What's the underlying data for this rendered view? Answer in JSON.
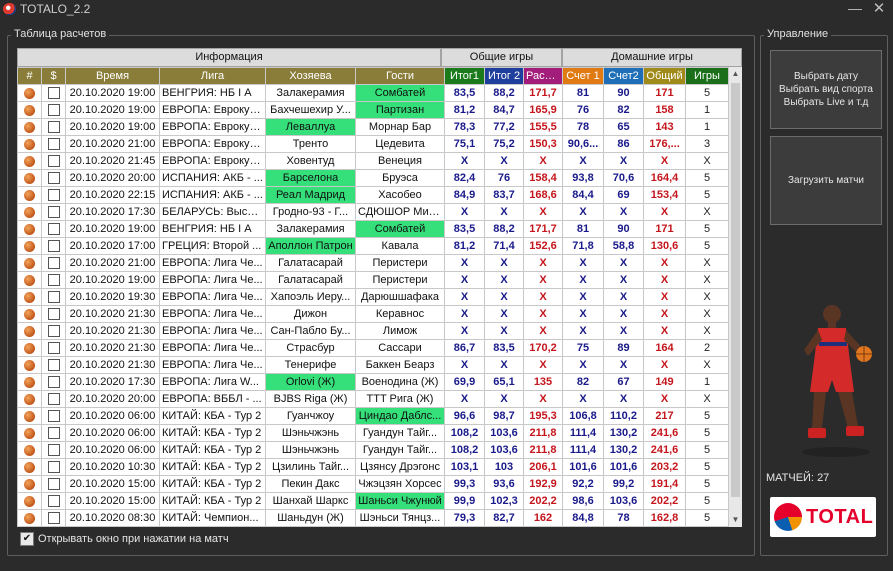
{
  "window": {
    "title": "TOTALO_2.2",
    "minimize": "—",
    "close": "✕"
  },
  "table_group": {
    "legend": "Таблица расчетов"
  },
  "groups": [
    "Информация",
    "Общие игры",
    "Домашние игры"
  ],
  "columns": [
    {
      "label": "#",
      "bg": "#8a7d3a"
    },
    {
      "label": "$",
      "bg": "#8a7d3a"
    },
    {
      "label": "Время",
      "bg": "#8a7d3a"
    },
    {
      "label": "Лига",
      "bg": "#8a7d3a"
    },
    {
      "label": "Хозяева",
      "bg": "#8a7d3a"
    },
    {
      "label": "Гости",
      "bg": "#8a7d3a"
    },
    {
      "label": "Итог1",
      "bg": "#1b7a1b"
    },
    {
      "label": "Итог 2",
      "bg": "#1f3f9c"
    },
    {
      "label": "Расчет",
      "bg": "#a31e7a"
    },
    {
      "label": "Счет 1",
      "bg": "#e07b14"
    },
    {
      "label": "Счет2",
      "bg": "#1f6fb8"
    },
    {
      "label": "Общий",
      "bg": "#a08a1a"
    },
    {
      "label": "Игры",
      "bg": "#1b6f1b"
    }
  ],
  "colors": {
    "highlight": "#35e07a",
    "blue": "#1a1a8a",
    "red": "#c4161c",
    "green": "#0e6a16"
  },
  "rows": [
    {
      "time": "20.10.2020 19:00",
      "league": "ВЕНГРИЯ: НБ I А",
      "home": "Залакерамия",
      "away": "Сомбатей",
      "hl": "away",
      "i1": "83,5",
      "i2": "88,2",
      "calc": "171,7",
      "s1": "81",
      "s2": "90",
      "tot": "171",
      "g": "5"
    },
    {
      "time": "20.10.2020 19:00",
      "league": "ЕВРОПА: Еврокуб...",
      "home": "Бахчешехир У...",
      "away": "Партизан",
      "hl": "away",
      "i1": "81,2",
      "i2": "84,7",
      "calc": "165,9",
      "s1": "76",
      "s2": "82",
      "tot": "158",
      "g": "1"
    },
    {
      "time": "20.10.2020 19:00",
      "league": "ЕВРОПА: Еврокуб...",
      "home": "Леваллуа",
      "away": "Морнар Бар",
      "hl": "home",
      "i1": "78,3",
      "i2": "77,2",
      "calc": "155,5",
      "s1": "78",
      "s2": "65",
      "tot": "143",
      "g": "1"
    },
    {
      "time": "20.10.2020 21:00",
      "league": "ЕВРОПА: Еврокуб...",
      "home": "Тренто",
      "away": "Цедевита",
      "hl": "",
      "i1": "75,1",
      "i2": "75,2",
      "calc": "150,3",
      "s1": "90,6...",
      "s2": "86",
      "tot": "176,...",
      "g": "3"
    },
    {
      "time": "20.10.2020 21:45",
      "league": "ЕВРОПА: Еврокуб...",
      "home": "Ховентуд",
      "away": "Венеция",
      "hl": "",
      "i1": "X",
      "i2": "X",
      "calc": "X",
      "s1": "X",
      "s2": "X",
      "tot": "X",
      "g": "X"
    },
    {
      "time": "20.10.2020 20:00",
      "league": "ИСПАНИЯ: АКБ - ...",
      "home": "Барселона",
      "away": "Бруэса",
      "hl": "home",
      "i1": "82,4",
      "i2": "76",
      "calc": "158,4",
      "s1": "93,8",
      "s2": "70,6",
      "tot": "164,4",
      "g": "5"
    },
    {
      "time": "20.10.2020 22:15",
      "league": "ИСПАНИЯ: АКБ - ...",
      "home": "Реал Мадрид",
      "away": "Хасобео",
      "hl": "home",
      "i1": "84,9",
      "i2": "83,7",
      "calc": "168,6",
      "s1": "84,4",
      "s2": "69",
      "tot": "153,4",
      "g": "5"
    },
    {
      "time": "20.10.2020 17:30",
      "league": "БЕЛАРУСЬ: Высш...",
      "home": "Гродно-93 - Г...",
      "away": "СДЮШОР Минск",
      "hl": "",
      "i1": "X",
      "i2": "X",
      "calc": "X",
      "s1": "X",
      "s2": "X",
      "tot": "X",
      "g": "X"
    },
    {
      "time": "20.10.2020 19:00",
      "league": "ВЕНГРИЯ: НБ I А",
      "home": "Залакерамия",
      "away": "Сомбатей",
      "hl": "away",
      "i1": "83,5",
      "i2": "88,2",
      "calc": "171,7",
      "s1": "81",
      "s2": "90",
      "tot": "171",
      "g": "5"
    },
    {
      "time": "20.10.2020 17:00",
      "league": "ГРЕЦИЯ: Второй ...",
      "home": "Аполлон Патрон",
      "away": "Кавала",
      "hl": "home",
      "i1": "81,2",
      "i2": "71,4",
      "calc": "152,6",
      "s1": "71,8",
      "s2": "58,8",
      "tot": "130,6",
      "g": "5"
    },
    {
      "time": "20.10.2020 21:00",
      "league": "ЕВРОПА: Лига Че...",
      "home": "Галатасарай",
      "away": "Перистери",
      "hl": "",
      "i1": "X",
      "i2": "X",
      "calc": "X",
      "s1": "X",
      "s2": "X",
      "tot": "X",
      "g": "X"
    },
    {
      "time": "20.10.2020 19:00",
      "league": "ЕВРОПА: Лига Че...",
      "home": "Галатасарай",
      "away": "Перистери",
      "hl": "",
      "i1": "X",
      "i2": "X",
      "calc": "X",
      "s1": "X",
      "s2": "X",
      "tot": "X",
      "g": "X"
    },
    {
      "time": "20.10.2020 19:30",
      "league": "ЕВРОПА: Лига Че...",
      "home": "Хапоэль Иеру...",
      "away": "Дарюшшафака",
      "hl": "",
      "i1": "X",
      "i2": "X",
      "calc": "X",
      "s1": "X",
      "s2": "X",
      "tot": "X",
      "g": "X"
    },
    {
      "time": "20.10.2020 21:30",
      "league": "ЕВРОПА: Лига Че...",
      "home": "Дижон",
      "away": "Керавнос",
      "hl": "",
      "i1": "X",
      "i2": "X",
      "calc": "X",
      "s1": "X",
      "s2": "X",
      "tot": "X",
      "g": "X"
    },
    {
      "time": "20.10.2020 21:30",
      "league": "ЕВРОПА: Лига Че...",
      "home": "Сан-Пабло Бу...",
      "away": "Лимож",
      "hl": "",
      "i1": "X",
      "i2": "X",
      "calc": "X",
      "s1": "X",
      "s2": "X",
      "tot": "X",
      "g": "X"
    },
    {
      "time": "20.10.2020 21:30",
      "league": "ЕВРОПА: Лига Че...",
      "home": "Страсбур",
      "away": "Сассари",
      "hl": "",
      "i1": "86,7",
      "i2": "83,5",
      "calc": "170,2",
      "s1": "75",
      "s2": "89",
      "tot": "164",
      "g": "2"
    },
    {
      "time": "20.10.2020 21:30",
      "league": "ЕВРОПА: Лига Че...",
      "home": "Тенерифе",
      "away": "Баккен Беарз",
      "hl": "",
      "i1": "X",
      "i2": "X",
      "calc": "X",
      "s1": "X",
      "s2": "X",
      "tot": "X",
      "g": "X"
    },
    {
      "time": "20.10.2020 17:30",
      "league": "ЕВРОПА: Лига W...",
      "home": "Orlovi (Ж)",
      "away": "Военодина (Ж)",
      "hl": "home",
      "i1": "69,9",
      "i2": "65,1",
      "calc": "135",
      "s1": "82",
      "s2": "67",
      "tot": "149",
      "g": "1"
    },
    {
      "time": "20.10.2020 20:00",
      "league": "ЕВРОПА: ВББЛ - ...",
      "home": "BJBS Riga (Ж)",
      "away": "TTT Рига (Ж)",
      "hl": "",
      "i1": "X",
      "i2": "X",
      "calc": "X",
      "s1": "X",
      "s2": "X",
      "tot": "X",
      "g": "X"
    },
    {
      "time": "20.10.2020 06:00",
      "league": "КИТАЙ: КБА - Тур 2",
      "home": "Гуанчжоу",
      "away": "Циндао Даблс...",
      "hl": "away",
      "i1": "96,6",
      "i2": "98,7",
      "calc": "195,3",
      "s1": "106,8",
      "s2": "110,2",
      "tot": "217",
      "g": "5"
    },
    {
      "time": "20.10.2020 06:00",
      "league": "КИТАЙ: КБА - Тур 2",
      "home": "Шэньчжэнь",
      "away": "Гуандун Тайг...",
      "hl": "",
      "i1": "108,2",
      "i2": "103,6",
      "calc": "211,8",
      "s1": "111,4",
      "s2": "130,2",
      "tot": "241,6",
      "g": "5"
    },
    {
      "time": "20.10.2020 06:00",
      "league": "КИТАЙ: КБА - Тур 2",
      "home": "Шэньчжэнь",
      "away": "Гуандун Тайг...",
      "hl": "",
      "i1": "108,2",
      "i2": "103,6",
      "calc": "211,8",
      "s1": "111,4",
      "s2": "130,2",
      "tot": "241,6",
      "g": "5"
    },
    {
      "time": "20.10.2020 10:30",
      "league": "КИТАЙ: КБА - Тур 2",
      "home": "Цзилинь Тайг...",
      "away": "Цзянсу Дрэгонс",
      "hl": "",
      "i1": "103,1",
      "i2": "103",
      "calc": "206,1",
      "s1": "101,6",
      "s2": "101,6",
      "tot": "203,2",
      "g": "5"
    },
    {
      "time": "20.10.2020 15:00",
      "league": "КИТАЙ: КБА - Тур 2",
      "home": "Пекин Дакс",
      "away": "Чжэцзян Хорсес",
      "hl": "",
      "i1": "99,3",
      "i2": "93,6",
      "calc": "192,9",
      "s1": "92,2",
      "s2": "99,2",
      "tot": "191,4",
      "g": "5"
    },
    {
      "time": "20.10.2020 15:00",
      "league": "КИТАЙ: КБА - Тур 2",
      "home": "Шанхай Шаркс",
      "away": "Шаньси Чжунюй",
      "hl": "away",
      "i1": "99,9",
      "i2": "102,3",
      "calc": "202,2",
      "s1": "98,6",
      "s2": "103,6",
      "tot": "202,2",
      "g": "5"
    },
    {
      "time": "20.10.2020 08:30",
      "league": "КИТАЙ: Чемпион...",
      "home": "Шаньдун (Ж)",
      "away": "Шэньси Тянцз...",
      "hl": "",
      "i1": "79,3",
      "i2": "82,7",
      "calc": "162",
      "s1": "84,8",
      "s2": "78",
      "tot": "162,8",
      "g": "5"
    }
  ],
  "scroll": {
    "up": "▲",
    "down": "▼"
  },
  "open_window_option": {
    "checked": true,
    "mark": "✔",
    "label": "Открывать окно при нажатии на матч"
  },
  "control": {
    "legend": "Управление",
    "select_button": "Выбрать дату\nВыбрать вид спорта\nВыбрать Live и т.д",
    "load_button": "Загрузить матчи",
    "matches_label": "МАТЧЕЙ:",
    "matches_count": "27",
    "logo_text": "TOTAL"
  }
}
